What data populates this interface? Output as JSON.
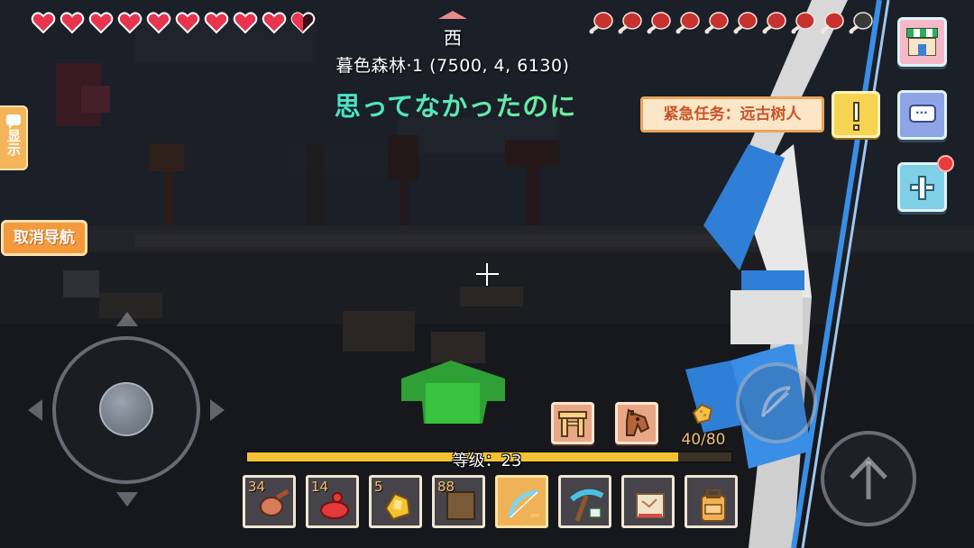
{
  "hud": {
    "compass_direction": "西",
    "location": "暮色森林·1  (7500, 4, 6130)",
    "subtitle": "思ってなかったのに",
    "hearts": {
      "full": 9,
      "half": 1,
      "max": 10
    },
    "hunger": {
      "full": 9,
      "empty": 1,
      "max": 10
    },
    "level_label": "等级：23",
    "xp_fraction": 0.89,
    "hunger_count": "40/80",
    "colors": {
      "heart": "#e8344e",
      "meat": "#c8322e",
      "xp": "#f3c232",
      "subtitle_from": "#3ee0d6",
      "subtitle_to": "#7cf08c"
    }
  },
  "left_panel": {
    "show_tab": "显示",
    "cancel_nav": "取消导航"
  },
  "quest": {
    "label": "紧急任务：远古树人",
    "alert_icon": "exclamation-icon"
  },
  "right_panel": {
    "buttons": [
      "shop-icon",
      "chat-icon",
      "plus-icon"
    ],
    "plus_has_notification": true
  },
  "quick_actions": [
    "workbench-icon",
    "horse-icon"
  ],
  "hotbar": [
    {
      "name": "raw-meat-icon",
      "count": "34",
      "selected": false
    },
    {
      "name": "red-potion-icon",
      "count": "14",
      "selected": false
    },
    {
      "name": "gold-ore-icon",
      "count": "5",
      "selected": false
    },
    {
      "name": "dirt-block-icon",
      "count": "88",
      "selected": false
    },
    {
      "name": "bow-icon",
      "count": "",
      "selected": true
    },
    {
      "name": "pickaxe-icon",
      "count": "",
      "selected": false
    },
    {
      "name": "map-scroll-icon",
      "count": "",
      "selected": false
    },
    {
      "name": "backpack-icon",
      "count": "",
      "selected": false
    }
  ],
  "controls": [
    "joystick",
    "aim-button",
    "jump-button"
  ]
}
